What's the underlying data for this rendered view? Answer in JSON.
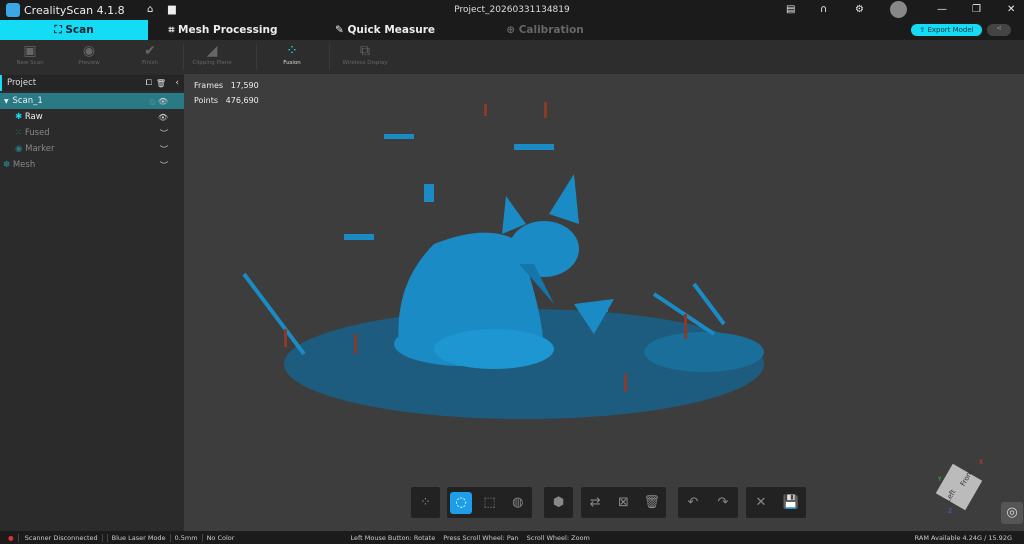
{
  "app": {
    "name": "CrealityScan 4.1.8",
    "project_title": "Project_20260331134819"
  },
  "tabs": [
    {
      "label": "Scan",
      "icon": "scan-frame-icon"
    },
    {
      "label": "Mesh Processing",
      "icon": "crop-icon"
    },
    {
      "label": "Quick Measure",
      "icon": "ruler-icon"
    },
    {
      "label": "Calibration",
      "icon": "target-icon"
    }
  ],
  "header": {
    "export_label": "Export Model"
  },
  "toolbar": [
    {
      "label": "New Scan"
    },
    {
      "label": "Preview"
    },
    {
      "label": "Finish"
    },
    {
      "label": "Clipping Plane"
    },
    {
      "label": "Fusion"
    },
    {
      "label": "Wireless Display"
    }
  ],
  "sidebar": {
    "title": "Project",
    "items": [
      {
        "label": "Scan_1"
      },
      {
        "label": "Raw"
      },
      {
        "label": "Fused"
      },
      {
        "label": "Marker"
      },
      {
        "label": "Mesh"
      }
    ]
  },
  "stats": {
    "frames_label": "Frames",
    "frames": "17,590",
    "points_label": "Points",
    "points": "476,690"
  },
  "viewcube": {
    "front": "Front",
    "left": "Left",
    "x": "X",
    "y": "Y",
    "z": "Z"
  },
  "status": {
    "scanner": "Scanner Disconnected",
    "mode": "Blue Laser Mode",
    "resolution": "0.5mm",
    "color": "No Color",
    "hint_rotate": "Left Mouse Button: Rotate",
    "hint_pan": "Press Scroll Wheel: Pan",
    "hint_zoom": "Scroll Wheel: Zoom",
    "ram": "RAM Available 4.24G / 15.92G"
  },
  "colors": {
    "accent": "#14dcf5",
    "model": "#1a8bc4",
    "selected_row": "#2a7a86",
    "error": "#e03030"
  }
}
